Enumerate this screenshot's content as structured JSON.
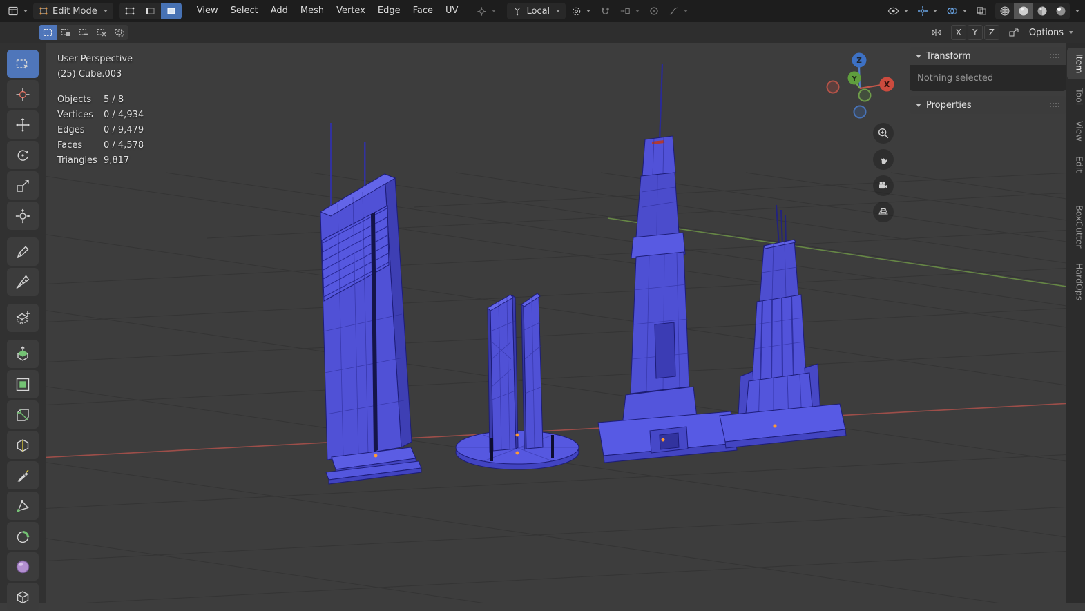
{
  "topbar": {
    "mode_label": "Edit Mode",
    "menus": [
      "View",
      "Select",
      "Add",
      "Mesh",
      "Vertex",
      "Edge",
      "Face",
      "UV"
    ],
    "orientation_label": "Local"
  },
  "toolrow": {
    "axis_toggles": [
      "X",
      "Y",
      "Z"
    ],
    "options_label": "Options"
  },
  "left_toolbar": {
    "tools": [
      {
        "name": "box-select",
        "icon": "box_select",
        "active": true
      },
      {
        "name": "cursor",
        "icon": "cursor"
      },
      {
        "name": "move",
        "icon": "move"
      },
      {
        "name": "rotate",
        "icon": "rotate"
      },
      {
        "name": "scale",
        "icon": "scale"
      },
      {
        "name": "transform",
        "icon": "transform"
      },
      {
        "name": "annotate",
        "icon": "annotate"
      },
      {
        "name": "measure",
        "icon": "measure"
      },
      {
        "name": "add-cube",
        "icon": "add_cube"
      },
      {
        "name": "extrude-region",
        "icon": "extrude"
      },
      {
        "name": "inset-faces",
        "icon": "inset"
      },
      {
        "name": "bevel",
        "icon": "bevel"
      },
      {
        "name": "loop-cut",
        "icon": "loop_cut"
      },
      {
        "name": "knife",
        "icon": "knife"
      },
      {
        "name": "poly-build",
        "icon": "poly_build"
      },
      {
        "name": "spin",
        "icon": "spin"
      },
      {
        "name": "smooth",
        "icon": "smooth"
      },
      {
        "name": "rip-region",
        "icon": "rip"
      }
    ]
  },
  "viewport": {
    "perspective_label": "User Perspective",
    "object_label": "(25) Cube.003",
    "stats": [
      {
        "label": "Objects",
        "value": "5 / 8"
      },
      {
        "label": "Vertices",
        "value": "0 / 4,934"
      },
      {
        "label": "Edges",
        "value": "0 / 9,479"
      },
      {
        "label": "Faces",
        "value": "0 / 4,578"
      },
      {
        "label": "Triangles",
        "value": "9,817"
      }
    ],
    "gizmo": {
      "x": "X",
      "y": "Y",
      "z": "Z"
    }
  },
  "sidebar": {
    "panels": [
      {
        "title": "Transform",
        "body": "Nothing selected"
      },
      {
        "title": "Properties"
      }
    ],
    "tabs": [
      {
        "label": "Item",
        "active": true
      },
      {
        "label": "Tool"
      },
      {
        "label": "View"
      },
      {
        "label": "Edit"
      },
      {
        "label": "BoxCutter"
      },
      {
        "label": "HardOps"
      }
    ]
  },
  "colors": {
    "accent_blue": "#4772b4",
    "building_fill": "#5051d6",
    "building_edge": "#1d1d78",
    "axis_x_red": "#a8504b",
    "axis_y_green": "#6e9447",
    "selected_vertex_orange": "#ff9a33"
  }
}
